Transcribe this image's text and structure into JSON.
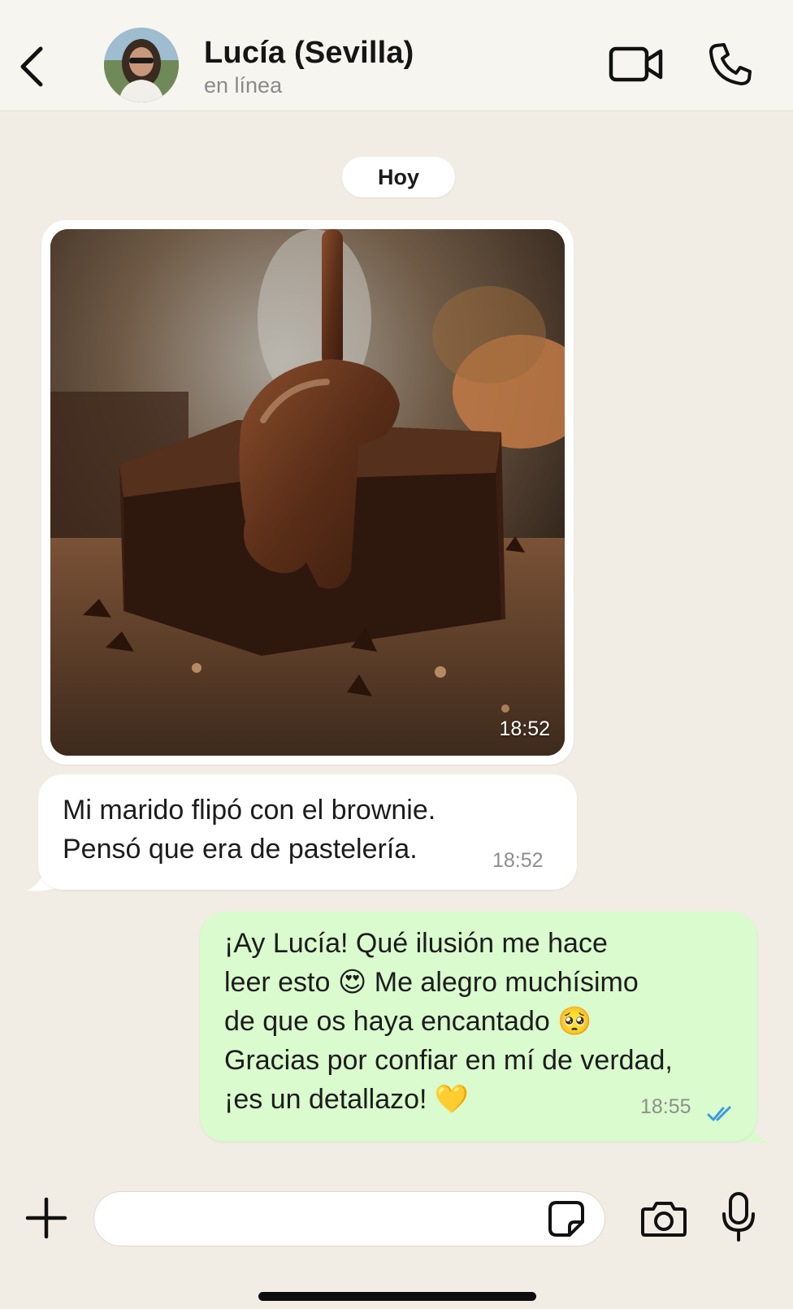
{
  "header": {
    "back_icon": "chevron-left-icon",
    "contact_name": "Lucía (Sevilla)",
    "status": "en línea",
    "video_icon": "video-camera-icon",
    "call_icon": "phone-icon"
  },
  "chat": {
    "date_label": "Hoy",
    "messages": [
      {
        "type": "image",
        "direction": "incoming",
        "time": "18:52"
      },
      {
        "type": "text",
        "direction": "incoming",
        "text": "Mi marido flipó con el brownie.\nPensó que era de pastelería.",
        "time": "18:52"
      },
      {
        "type": "text",
        "direction": "outgoing",
        "text": "¡Ay Lucía! Qué ilusión me hace\nleer esto 😍 Me alegro muchísimo\nde que os haya encantado 🥺\nGracias por confiar en mí de verdad,\n¡es un detallazo! 💛",
        "time": "18:55",
        "status": "read"
      }
    ]
  },
  "composer": {
    "plus_icon": "plus-icon",
    "input_value": "",
    "sticker_icon": "sticker-icon",
    "camera_icon": "camera-icon",
    "mic_icon": "microphone-icon"
  },
  "colors": {
    "background": "#f2ede4",
    "incoming_bubble": "#ffffff",
    "outgoing_bubble": "#d9fbcd",
    "read_ticks": "#3a9be0"
  }
}
